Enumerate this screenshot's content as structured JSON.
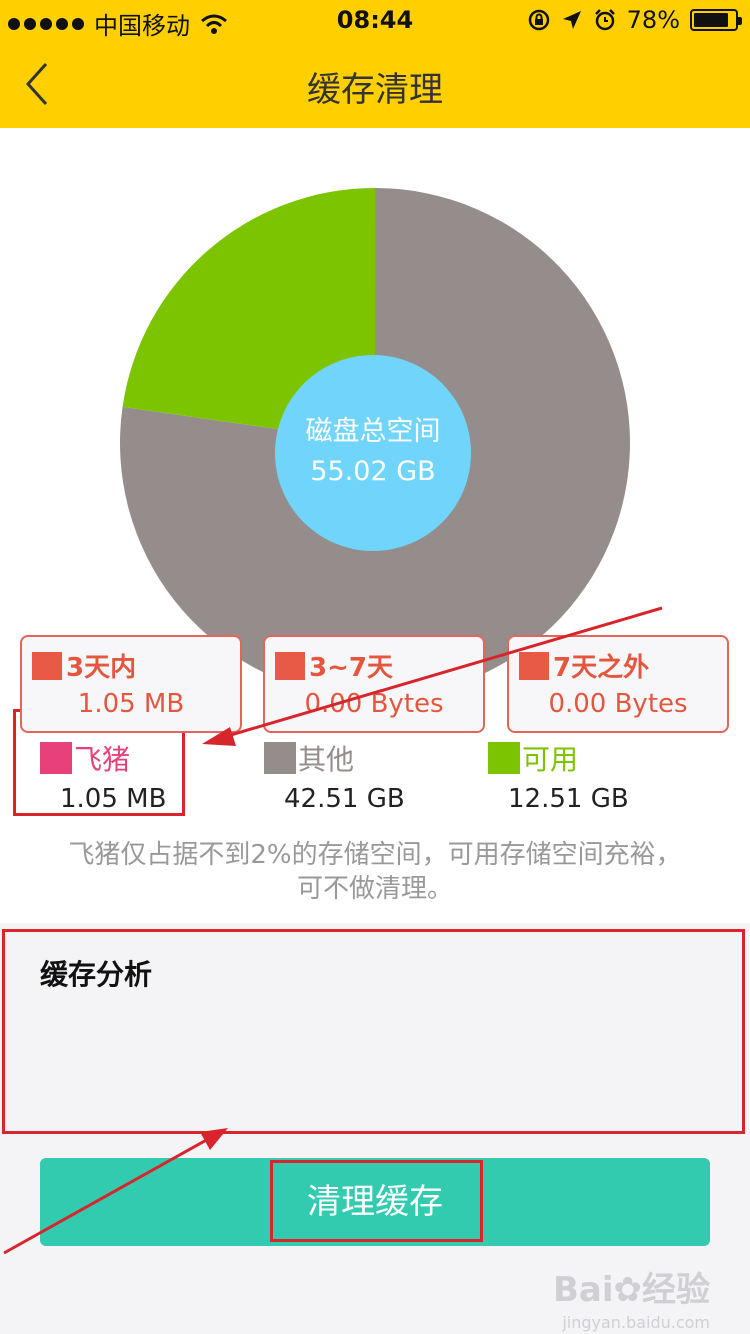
{
  "status_bar": {
    "carrier": "中国移动",
    "time": "08:44",
    "battery": "78%",
    "battery_level": 0.78
  },
  "nav": {
    "title": "缓存清理",
    "back_icon": "chevron-left-icon"
  },
  "chart_data": {
    "type": "pie",
    "title": "磁盘总空间",
    "total": "55.02 GB",
    "slices": [
      {
        "name": "飞猪",
        "value_label": "1.05 MB",
        "value_gb": 0.001,
        "color": "#e8407a"
      },
      {
        "name": "其他",
        "value_label": "42.51 GB",
        "value_gb": 42.51,
        "color": "#958d8b"
      },
      {
        "name": "可用",
        "value_label": "12.51 GB",
        "value_gb": 12.51,
        "color": "#7dc400"
      }
    ]
  },
  "note": {
    "line1": "飞猪仅占据不到2%的存储空间，可用存储空间充裕，",
    "line2": "可不做清理。"
  },
  "analysis": {
    "title": "缓存分析",
    "color": "#e85a45",
    "cards": [
      {
        "label": "3天内",
        "value": "1.05 MB"
      },
      {
        "label": "3~7天",
        "value": "0.00 Bytes"
      },
      {
        "label": "7天之外",
        "value": "0.00 Bytes"
      }
    ]
  },
  "action": {
    "clean_label": "清理缓存",
    "color": "#33cbaf"
  },
  "watermark": {
    "brand": "Bai",
    "brand2": "经验",
    "url": "jingyan.baidu.com"
  },
  "annotations": {
    "color": "#d8252c"
  }
}
